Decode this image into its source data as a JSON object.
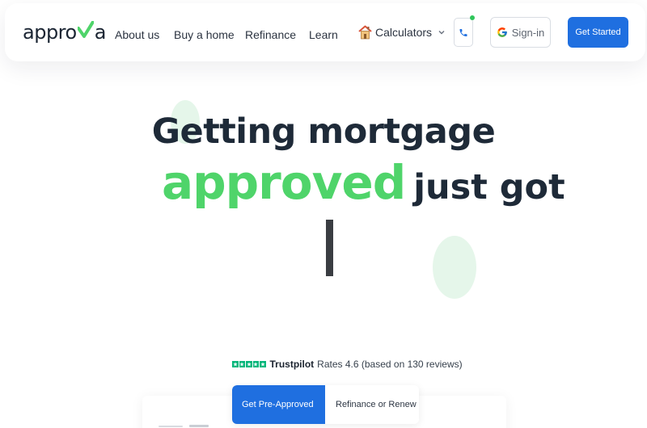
{
  "nav": {
    "logo_pre": "appro",
    "logo_post": "a",
    "links": [
      "About us",
      "Buy a home",
      "Refinance",
      "Learn"
    ],
    "calculators": "Calculators",
    "signin": "Sign-in",
    "get_started": "Get Started"
  },
  "hero": {
    "line1": "Getting mortgage",
    "highlight": "approved",
    "line2_rest": "just got"
  },
  "trust": {
    "brand": "Trustpilot",
    "text": "Rates 4.6 (based on 130 reviews)",
    "rating": 4.6
  },
  "tabs": [
    {
      "label": "Get Pre-Approved",
      "active": true
    },
    {
      "label": "Refinance or Renew",
      "active": false
    }
  ],
  "colors": {
    "brand_green": "#4fd46a",
    "primary_blue": "#1f6fe0",
    "trustpilot_green": "#00b67a"
  },
  "icons": [
    "check-logo-icon",
    "house-icon",
    "chevron-down-icon",
    "phone-icon",
    "google-icon",
    "star-icon",
    "info-icon"
  ]
}
